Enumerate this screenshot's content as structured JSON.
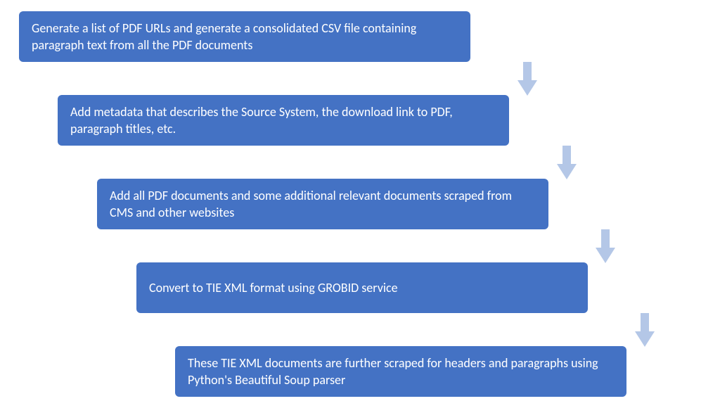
{
  "diagram": {
    "type": "flowchart",
    "direction": "top-to-bottom",
    "box_color": "#4472C4",
    "arrow_color": "#B4C7E7",
    "steps": [
      {
        "text": "Generate a list of PDF URLs and generate a consolidated CSV file containing paragraph text from all the PDF documents"
      },
      {
        "text": "Add metadata that describes the Source System, the download link to PDF, paragraph titles, etc."
      },
      {
        "text": "Add all PDF documents and some additional relevant documents scraped from CMS and other websites"
      },
      {
        "text": "Convert to TIE XML format using GROBID service"
      },
      {
        "text": "These TIE XML documents are further scraped for headers and paragraphs using Python's Beautiful Soup parser"
      }
    ]
  }
}
